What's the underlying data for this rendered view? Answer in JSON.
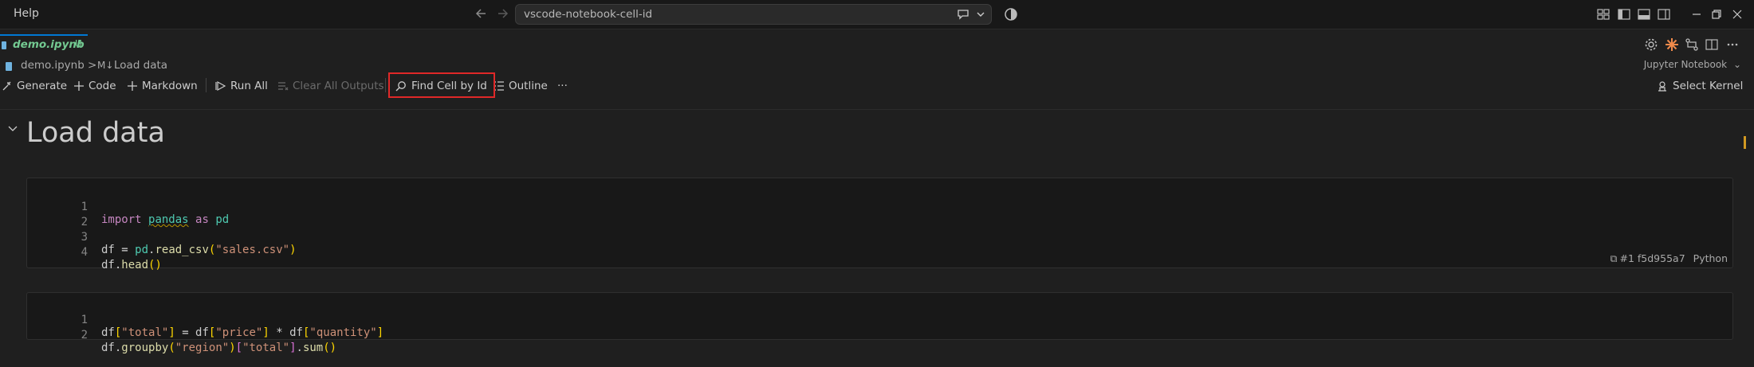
{
  "menu": {
    "help": "Help"
  },
  "command_center": {
    "text": "vscode-notebook-cell-id"
  },
  "tab": {
    "name": "demo.ipynb",
    "badge": "U"
  },
  "breadcrumb": {
    "file": "demo.ipynb",
    "separator": ">",
    "md_icon": "M↓",
    "section": "Load data"
  },
  "kernel_picker": {
    "label": "Jupyter Notebook"
  },
  "toolbar": {
    "generate": "Generate",
    "code": "Code",
    "markdown": "Markdown",
    "run_all": "Run All",
    "clear_all_outputs": "Clear All Outputs",
    "find_cell_by_id": "Find Cell by Id",
    "outline": "Outline",
    "more": "···",
    "select_kernel": "Select Kernel"
  },
  "markdown_cell": {
    "heading": "Load data"
  },
  "cells": [
    {
      "lines": [
        {
          "num": "1",
          "text": "import pandas as pd"
        },
        {
          "num": "2",
          "text": ""
        },
        {
          "num": "3",
          "text": "df = pd.read_csv(\"sales.csv\")"
        },
        {
          "num": "4",
          "text": "df.head()"
        }
      ],
      "cell_id": "#1 f5d955a7",
      "language": "Python"
    },
    {
      "lines": [
        {
          "num": "1",
          "text": "df[\"total\"] = df[\"price\"] * df[\"quantity\"]"
        },
        {
          "num": "2",
          "text": "df.groupby(\"region\")[\"total\"].sum()"
        }
      ]
    }
  ],
  "colors": {
    "accent": "#0078d4",
    "highlight": "#e02828",
    "untracked": "#73c991"
  }
}
